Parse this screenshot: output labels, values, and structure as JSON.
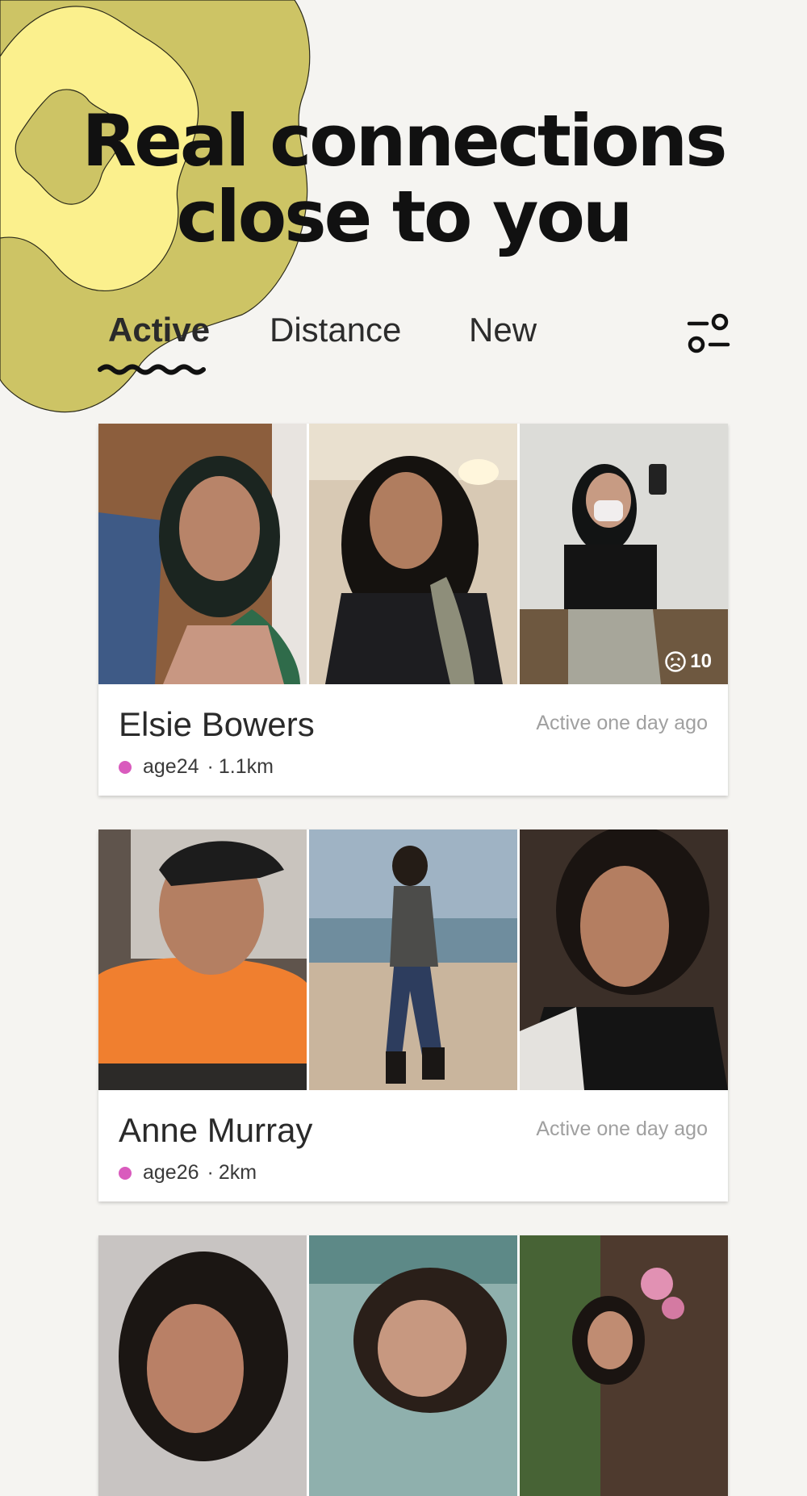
{
  "hero": {
    "line1": "Real connections",
    "line2": "close to you"
  },
  "tabs": [
    {
      "label": "Active",
      "selected": true
    },
    {
      "label": "Distance",
      "selected": false
    },
    {
      "label": "New",
      "selected": false
    }
  ],
  "filter_icon": "filter-sliders-icon",
  "colors": {
    "background": "#f5f4f1",
    "blob_outer": "#cdc465",
    "blob_middle": "#fbf08d",
    "online_dot": "#d95bbd",
    "muted_text": "#a0a0a0"
  },
  "profiles": [
    {
      "name": "Elsie Bowers",
      "active": "Active one day ago",
      "age": "age24",
      "distance": "1.1km",
      "photo_count": "10",
      "photo_count_icon": "sad-face-icon"
    },
    {
      "name": "Anne Murray",
      "active": "Active one day ago",
      "age": "age26",
      "distance": "2km"
    },
    {
      "name": "",
      "active": "",
      "age": "",
      "distance": ""
    }
  ]
}
